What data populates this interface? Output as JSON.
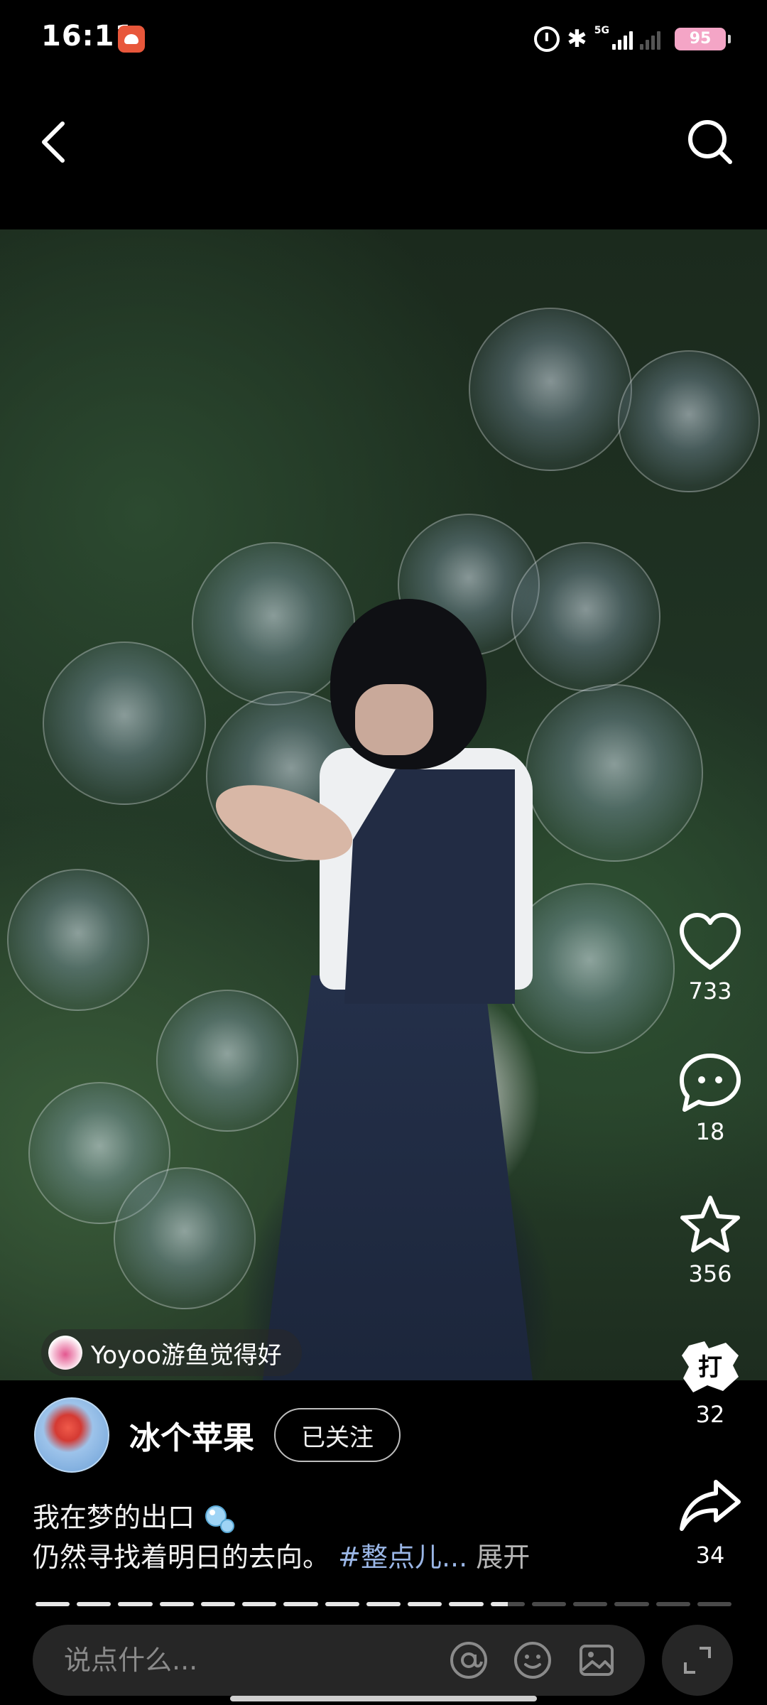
{
  "status_bar": {
    "time": "16:11",
    "network": "5G",
    "battery": "95"
  },
  "media": {
    "recommend_text": "Yoyoo游鱼觉得好"
  },
  "actions": {
    "like_count": "733",
    "comment_count": "18",
    "favorite_count": "356",
    "gift_count": "32",
    "share_count": "34"
  },
  "author": {
    "name": "冰个苹果",
    "follow_label": "已关注"
  },
  "caption": {
    "line1": "我在梦的出口",
    "line2": "仍然寻找着明日的去向。",
    "hashtag": "#整点儿...",
    "more": "展开"
  },
  "progress": {
    "total_segments": 17,
    "completed_segments": 11.5
  },
  "comment_bar": {
    "placeholder": "说点什么..."
  },
  "icons": [
    "back-icon",
    "search-icon",
    "heart-icon",
    "comment-icon",
    "star-icon",
    "gift-icon",
    "share-icon",
    "at-icon",
    "emoji-icon",
    "image-icon",
    "expand-icon",
    "alarm-icon",
    "bluetooth-icon",
    "signal-icon",
    "battery-icon"
  ]
}
